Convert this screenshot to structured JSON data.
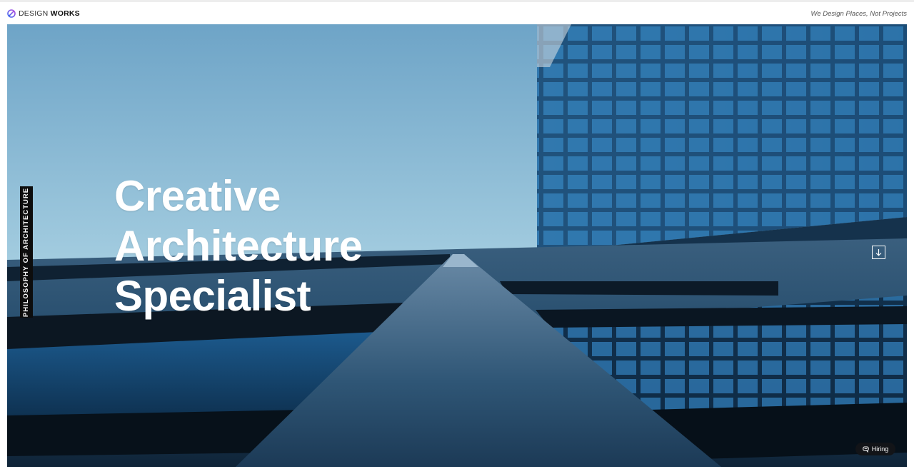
{
  "brand": {
    "name_light": "DESIGN",
    "name_bold": "WORKS",
    "accent_color": "#6a5cf0"
  },
  "header": {
    "tagline": "We Design Places, Not Projects"
  },
  "hero": {
    "side_label": "PHILOSOPHY OF ARCHITECTURE",
    "headline_lines": [
      "Creative",
      "Architecture",
      "Specialist"
    ],
    "scroll_icon": "arrow-down-icon",
    "hiring_label": "Hiring",
    "hiring_icon": "chat-icon"
  }
}
